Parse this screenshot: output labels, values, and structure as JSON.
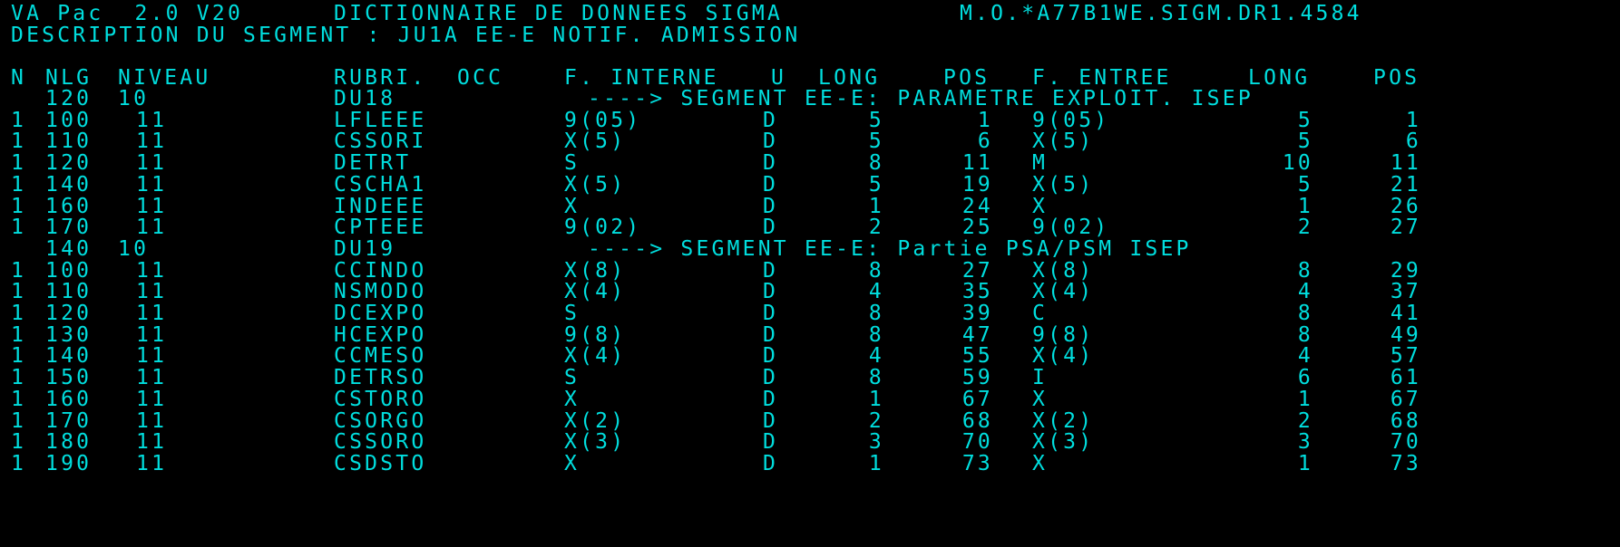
{
  "header": {
    "product": "VA Pac  2.0 V20",
    "title": "DICTIONNAIRE DE DONNEES SIGMA",
    "library": "M.O.*A77B1WE.SIGM.DR1.4584",
    "description": "DESCRIPTION DU SEGMENT : JU1A EE-E NOTIF. ADMISSION"
  },
  "columns": {
    "n": "N",
    "nlg": "NLG",
    "niveau": "NIVEAU",
    "rubri": "RUBRI.",
    "occ": "OCC",
    "f_interne": "F. INTERNE",
    "u": "U",
    "long": "LONG",
    "pos": "POS",
    "f_entree": "F. ENTREE",
    "long2": "LONG",
    "pos2": "POS"
  },
  "rows": [
    {
      "type": "group",
      "nlg": "120",
      "niveau": "10",
      "rubri": "DU18",
      "label": "----> SEGMENT EE-E: PARAMETRE EXPLOIT. ISEP"
    },
    {
      "type": "field",
      "n": "1",
      "nlg": "100",
      "niveau": "11",
      "rubri": "LFLEEE",
      "fint": "9(05)",
      "u": "D",
      "long": "5",
      "pos": "1",
      "fent": "9(05)",
      "long2": "5",
      "pos2": "1"
    },
    {
      "type": "field",
      "n": "1",
      "nlg": "110",
      "niveau": "11",
      "rubri": "CSSORI",
      "fint": "X(5)",
      "u": "D",
      "long": "5",
      "pos": "6",
      "fent": "X(5)",
      "long2": "5",
      "pos2": "6"
    },
    {
      "type": "field",
      "n": "1",
      "nlg": "120",
      "niveau": "11",
      "rubri": "DETRT",
      "fint": "S",
      "u": "D",
      "long": "8",
      "pos": "11",
      "fent": "M",
      "long2": "10",
      "pos2": "11"
    },
    {
      "type": "field",
      "n": "1",
      "nlg": "140",
      "niveau": "11",
      "rubri": "CSCHA1",
      "fint": "X(5)",
      "u": "D",
      "long": "5",
      "pos": "19",
      "fent": "X(5)",
      "long2": "5",
      "pos2": "21"
    },
    {
      "type": "field",
      "n": "1",
      "nlg": "160",
      "niveau": "11",
      "rubri": "INDEEE",
      "fint": "X",
      "u": "D",
      "long": "1",
      "pos": "24",
      "fent": "X",
      "long2": "1",
      "pos2": "26"
    },
    {
      "type": "field",
      "n": "1",
      "nlg": "170",
      "niveau": "11",
      "rubri": "CPTEEE",
      "fint": "9(02)",
      "u": "D",
      "long": "2",
      "pos": "25",
      "fent": "9(02)",
      "long2": "2",
      "pos2": "27"
    },
    {
      "type": "group",
      "nlg": "140",
      "niveau": "10",
      "rubri": "DU19",
      "label": "----> SEGMENT EE-E: Partie PSA/PSM ISEP"
    },
    {
      "type": "field",
      "n": "1",
      "nlg": "100",
      "niveau": "11",
      "rubri": "CCINDO",
      "fint": "X(8)",
      "u": "D",
      "long": "8",
      "pos": "27",
      "fent": "X(8)",
      "long2": "8",
      "pos2": "29"
    },
    {
      "type": "field",
      "n": "1",
      "nlg": "110",
      "niveau": "11",
      "rubri": "NSMODO",
      "fint": "X(4)",
      "u": "D",
      "long": "4",
      "pos": "35",
      "fent": "X(4)",
      "long2": "4",
      "pos2": "37"
    },
    {
      "type": "field",
      "n": "1",
      "nlg": "120",
      "niveau": "11",
      "rubri": "DCEXPO",
      "fint": "S",
      "u": "D",
      "long": "8",
      "pos": "39",
      "fent": "C",
      "long2": "8",
      "pos2": "41"
    },
    {
      "type": "field",
      "n": "1",
      "nlg": "130",
      "niveau": "11",
      "rubri": "HCEXPO",
      "fint": "9(8)",
      "u": "D",
      "long": "8",
      "pos": "47",
      "fent": "9(8)",
      "long2": "8",
      "pos2": "49"
    },
    {
      "type": "field",
      "n": "1",
      "nlg": "140",
      "niveau": "11",
      "rubri": "CCMESO",
      "fint": "X(4)",
      "u": "D",
      "long": "4",
      "pos": "55",
      "fent": "X(4)",
      "long2": "4",
      "pos2": "57"
    },
    {
      "type": "field",
      "n": "1",
      "nlg": "150",
      "niveau": "11",
      "rubri": "DETRSO",
      "fint": "S",
      "u": "D",
      "long": "8",
      "pos": "59",
      "fent": "I",
      "long2": "6",
      "pos2": "61"
    },
    {
      "type": "field",
      "n": "1",
      "nlg": "160",
      "niveau": "11",
      "rubri": "CSTORO",
      "fint": "X",
      "u": "D",
      "long": "1",
      "pos": "67",
      "fent": "X",
      "long2": "1",
      "pos2": "67"
    },
    {
      "type": "field",
      "n": "1",
      "nlg": "170",
      "niveau": "11",
      "rubri": "CSORGO",
      "fint": "X(2)",
      "u": "D",
      "long": "2",
      "pos": "68",
      "fent": "X(2)",
      "long2": "2",
      "pos2": "68"
    },
    {
      "type": "field",
      "n": "1",
      "nlg": "180",
      "niveau": "11",
      "rubri": "CSSORO",
      "fint": "X(3)",
      "u": "D",
      "long": "3",
      "pos": "70",
      "fent": "X(3)",
      "long2": "3",
      "pos2": "70"
    },
    {
      "type": "field",
      "n": "1",
      "nlg": "190",
      "niveau": "11",
      "rubri": "CSDSTO",
      "fint": "X",
      "u": "D",
      "long": "1",
      "pos": "73",
      "fent": "X",
      "long2": "1",
      "pos2": "73"
    }
  ],
  "colors": {
    "background": "#000000",
    "text": "#00dede"
  }
}
